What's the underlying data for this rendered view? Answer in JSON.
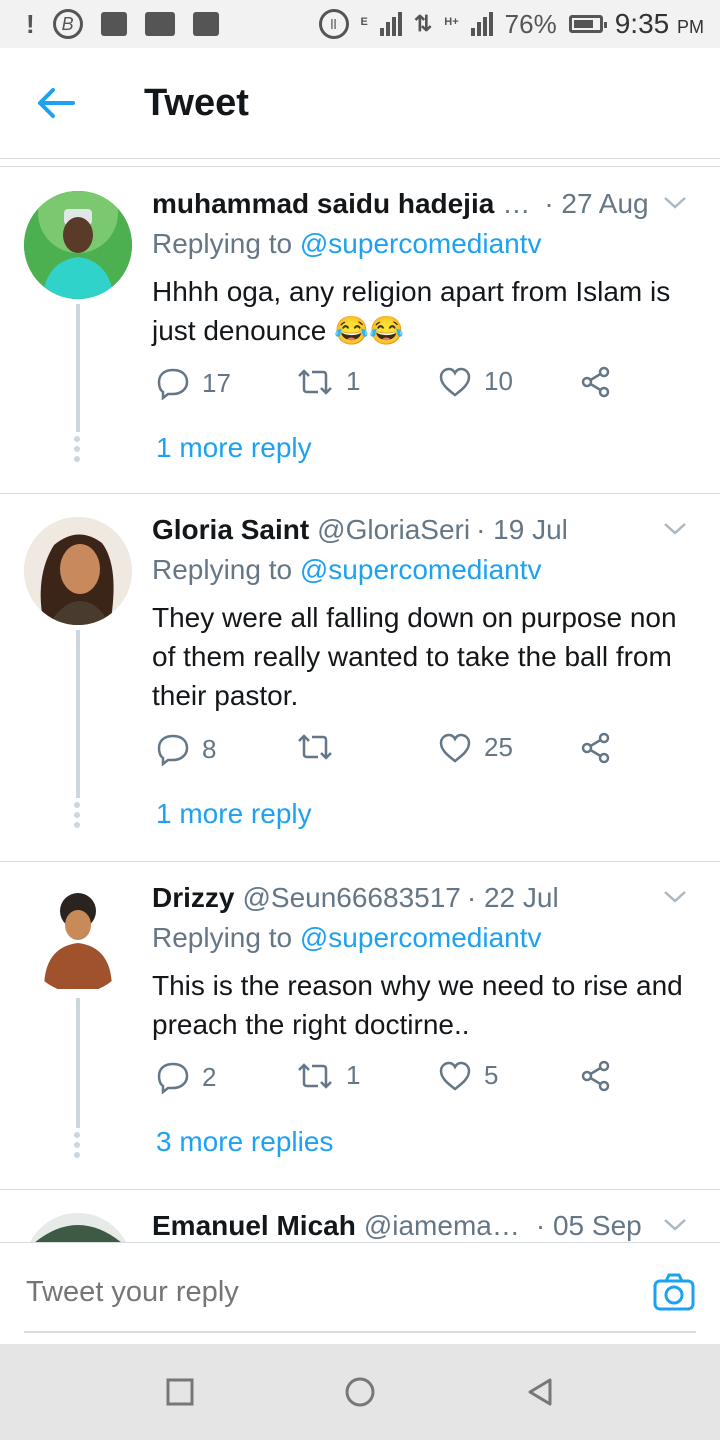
{
  "status_bar": {
    "battery": "76%",
    "time": "9:35",
    "ampm": "PM",
    "network_e": "E",
    "network_h": "H+",
    "icons": [
      "alert-icon",
      "b-icon",
      "image-icon",
      "activity-icon",
      "facebook-icon",
      "data-saver-icon",
      "signal-icon",
      "data-arrows-icon",
      "signal-icon",
      "battery-icon"
    ]
  },
  "header": {
    "title": "Tweet"
  },
  "tweets": [
    {
      "name": "muhammad saidu hadejia",
      "name_suffix": " …",
      "handle": "",
      "date": "· 27 Aug",
      "replying_prefix": "Replying to ",
      "replying_to": "@supercomediantv",
      "text": "Hhhh oga, any religion apart from Islam is just denounce 😂😂",
      "replies": "17",
      "retweets": "1",
      "likes": "10",
      "more": "1 more reply"
    },
    {
      "name": "Gloria Saint",
      "name_suffix": "",
      "handle": "@GloriaSeri",
      "date": "· 19 Jul",
      "replying_prefix": "Replying to ",
      "replying_to": "@supercomediantv",
      "text": "They were all falling down on purpose non of them really wanted to take the ball from their pastor.",
      "replies": "8",
      "retweets": "",
      "likes": "25",
      "more": "1 more reply"
    },
    {
      "name": "Drizzy",
      "name_suffix": "",
      "handle": "@Seun66683517",
      "date": "· 22 Jul",
      "replying_prefix": "Replying to ",
      "replying_to": "@supercomediantv",
      "text": "This is the reason why we need to rise and preach the right doctirne..",
      "replies": "2",
      "retweets": "1",
      "likes": "5",
      "more": "3 more replies"
    },
    {
      "name": "Emanuel Micah",
      "name_suffix": "",
      "handle": "@iamema…",
      "date": "· 05 Sep"
    }
  ],
  "reply_box": {
    "placeholder": "Tweet your reply"
  },
  "colors": {
    "accent": "#1da1f2",
    "secondary_text": "#657786",
    "divider": "#d8dde1"
  }
}
